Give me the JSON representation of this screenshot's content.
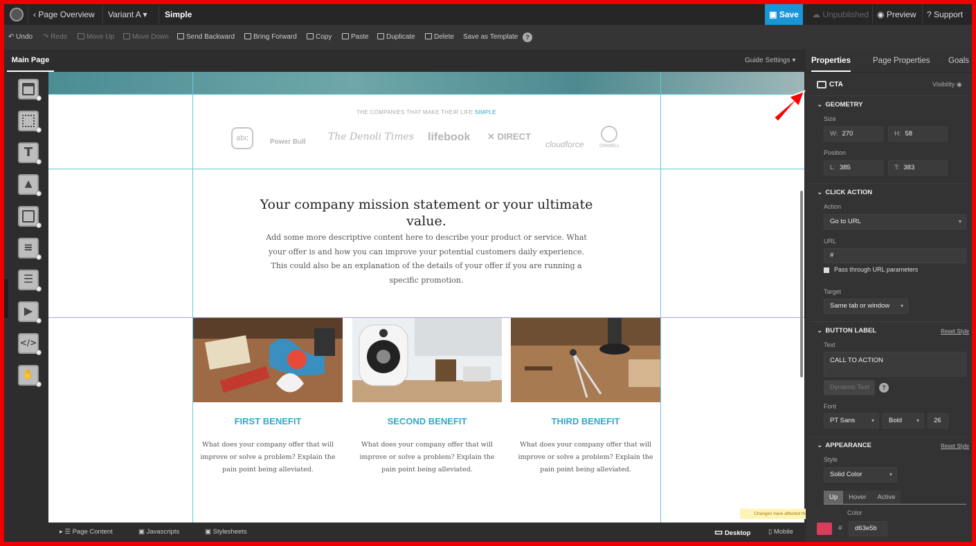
{
  "topbar": {
    "back": "‹ Page Overview",
    "variant": "Variant A",
    "page_name": "Simple",
    "save": "Save",
    "unpublished": "Unpublished",
    "preview": "Preview",
    "support": "Support"
  },
  "toolbar": {
    "undo": "Undo",
    "redo": "Redo",
    "move_up": "Move Up",
    "move_down": "Move Down",
    "send_backward": "Send Backward",
    "bring_forward": "Bring Forward",
    "copy": "Copy",
    "paste": "Paste",
    "duplicate": "Duplicate",
    "delete": "Delete",
    "save_template": "Save as Template"
  },
  "subbar": {
    "main_page": "Main Page",
    "guide_settings": "Guide Settings"
  },
  "canvas": {
    "logos_label": "THE COMPANIES THAT MAKE THEIR LIFE",
    "logos_label_highlight": "SIMPLE",
    "logos": [
      "abc",
      "Power Bull",
      "The Denoli Times",
      "lifebook",
      "✕ DIRECT",
      "cloudforce",
      "ORWELL"
    ],
    "mission_title": "Your company mission statement or your ultimate value.",
    "mission_desc": "Add some more descriptive content here to describe your product or service. What your offer is and how you can improve your potential customers daily experience. This could also be an explanation of the details of your offer if you are running a specific promotion.",
    "benefits": [
      {
        "title": "FIRST BENEFIT",
        "desc": "What does your company offer that will improve or solve a problem? Explain the pain point being alleviated."
      },
      {
        "title": "SECOND BENEFIT",
        "desc": "What does your company offer that will improve or solve a problem? Explain the pain point being alleviated."
      },
      {
        "title": "THIRD BENEFIT",
        "desc": "What does your company offer that will improve or solve a problem? Explain the pain point being alleviated."
      }
    ]
  },
  "bottombar": {
    "page_content": "Page Content",
    "javascripts": "Javascripts",
    "stylesheets": "Stylesheets",
    "desktop": "Desktop",
    "mobile": "Mobile",
    "tooltip": "Changes have affected the other view"
  },
  "panel": {
    "tabs": [
      "Properties",
      "Page Properties",
      "Goals"
    ],
    "element": "CTA",
    "visibility": "Visibility",
    "geometry": "GEOMETRY",
    "size": "Size",
    "w_label": "W:",
    "w": "270",
    "h_label": "H:",
    "h": "58",
    "position": "Position",
    "l_label": "L:",
    "l": "385",
    "t_label": "T:",
    "t": "383",
    "click_action": "CLICK ACTION",
    "action_label": "Action",
    "action": "Go to URL",
    "url_label": "URL",
    "url": "#",
    "pass_through": "Pass through URL parameters",
    "target_label": "Target",
    "target": "Same tab or window",
    "button_label": "BUTTON LABEL",
    "reset_style": "Reset Style",
    "text_label": "Text",
    "text": "CALL TO ACTION",
    "dynamic_text": "Dynamic Text",
    "font_label": "Font",
    "font": "PT Sans",
    "weight": "Bold",
    "font_size": "26",
    "appearance": "APPEARANCE",
    "style_label": "Style",
    "style": "Solid Color",
    "state_tabs": [
      "Up",
      "Hover",
      "Active"
    ],
    "bg_color_label": "Color",
    "hash": "#",
    "color": "d63e5b"
  },
  "colors": {
    "accent": "#1a96d8",
    "benefit": "#2eaac6",
    "cta": "#d63e5b"
  }
}
